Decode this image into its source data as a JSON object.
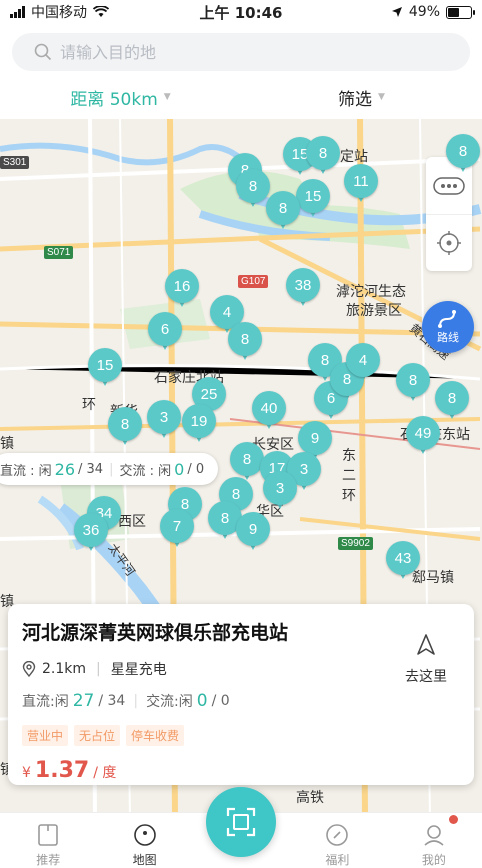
{
  "status": {
    "carrier": "中国移动",
    "time": "上午 10:46",
    "battery": "49%"
  },
  "search": {
    "placeholder": "请输入目的地"
  },
  "filters": {
    "distance": "距离 50km",
    "filter": "筛选"
  },
  "map": {
    "places": {
      "dingzhan": "定站",
      "hutuo": "滹沱河生态",
      "hutuo2": "旅游景区",
      "sjz_north": "石家庄北站",
      "xinhua": "新华",
      "huan": "环",
      "changan": "长安区",
      "dong": "东",
      "er": "二",
      "huan2": "环",
      "xi": "西区",
      "hua": "华区",
      "taiping": "太平河",
      "gaotie": "高铁",
      "sjz_east": "石家庄东站",
      "zhen": "镇",
      "zhen2": "镇",
      "zhen3": "镇",
      "huangshi": "黄石高速",
      "duma": "郄马镇"
    },
    "roads": {
      "s301": "S301",
      "s071": "S071",
      "g107": "G107",
      "s9902": "S9902"
    },
    "pins": [
      "15",
      "8",
      "8",
      "8",
      "15",
      "8",
      "11",
      "8",
      "16",
      "6",
      "4",
      "8",
      "38",
      "15",
      "25",
      "19",
      "3",
      "8",
      "40",
      "8",
      "6",
      "8",
      "4",
      "8",
      "8",
      "49",
      "9",
      "8",
      "17",
      "3",
      "3",
      "8",
      "8",
      "34",
      "36",
      "7",
      "8",
      "9",
      "43",
      "3",
      "8",
      "8",
      "9",
      "8",
      "8",
      "8",
      "8"
    ],
    "route_label": "路线",
    "tooltip": {
      "dc_label": "直流 : 闲",
      "dc_free": "26",
      "dc_total": "/ 34",
      "ac_label": "交流 : 闲",
      "ac_free": "0",
      "ac_total": "/ 0"
    }
  },
  "station": {
    "name": "河北源深菁英网球俱乐部充电站",
    "distance": "2.1km",
    "operator": "星星充电",
    "dc_label": "直流:闲",
    "dc_free": "27",
    "dc_total": "/ 34",
    "ac_label": "交流:闲",
    "ac_free": "0",
    "ac_total": "/ 0",
    "tags": [
      "营业中",
      "无占位",
      "停车收费"
    ],
    "currency": "¥",
    "price": "1.37",
    "unit": "/ 度",
    "go_label": "去这里"
  },
  "tabs": [
    {
      "label": "推荐"
    },
    {
      "label": "地图"
    },
    {
      "label": "福利"
    },
    {
      "label": "我的"
    }
  ],
  "colors": {
    "accent": "#2fb7a3",
    "pin": "#5cc9c9",
    "price": "#e2574c",
    "route": "#3a7ce6"
  }
}
